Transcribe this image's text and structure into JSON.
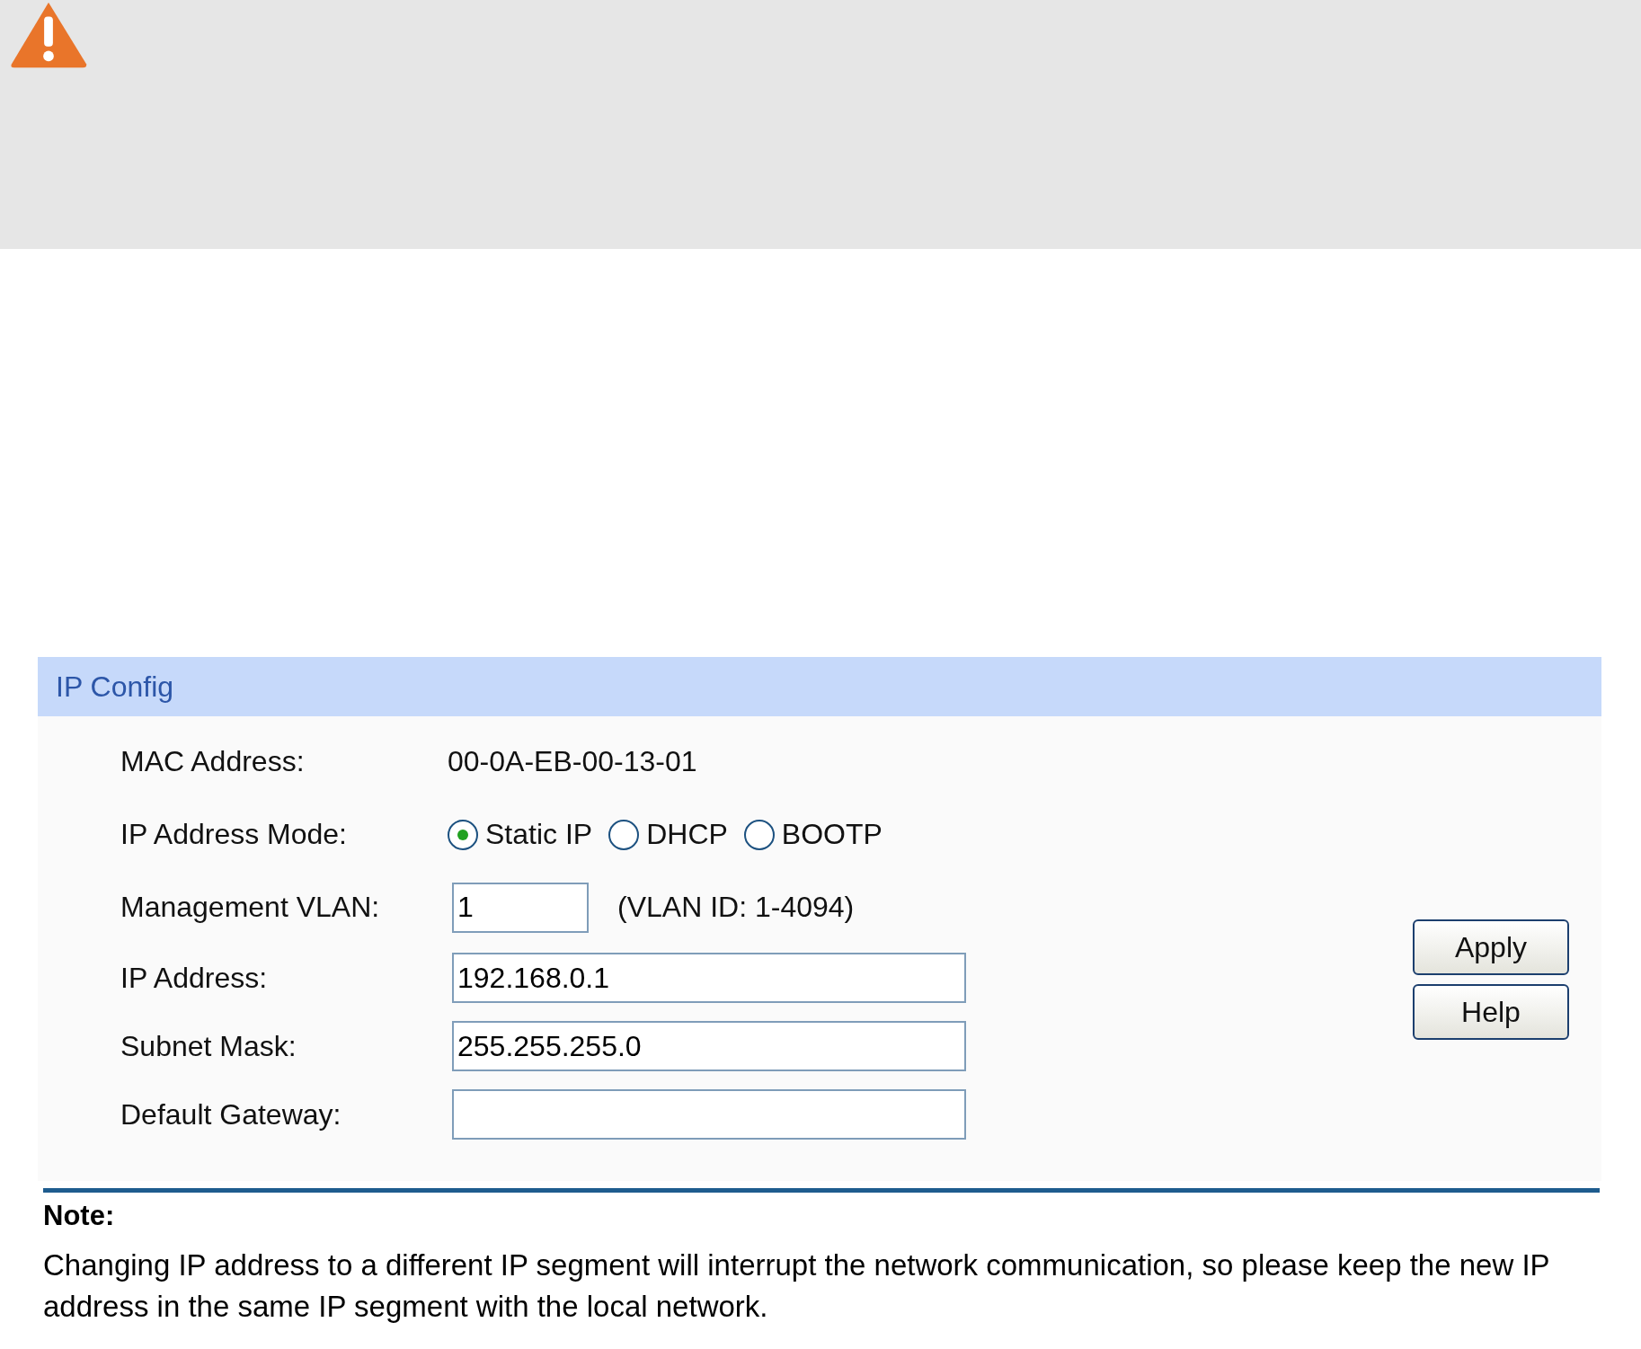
{
  "panel": {
    "title": "IP Config",
    "rows": [
      {
        "kind": "text",
        "label": "MAC Address:",
        "value": "00-0A-EB-00-13-01"
      },
      {
        "kind": "radio",
        "label": "IP Address Mode:",
        "options": [
          {
            "label": "Static IP",
            "selected": true
          },
          {
            "label": "DHCP",
            "selected": false
          },
          {
            "label": "BOOTP",
            "selected": false
          }
        ]
      },
      {
        "kind": "short",
        "label": "Management VLAN:",
        "value": "1",
        "hint": "(VLAN ID: 1-4094)"
      },
      {
        "kind": "field",
        "label": "IP Address:",
        "value": "192.168.0.1"
      },
      {
        "kind": "field",
        "label": "Subnet Mask:",
        "value": "255.255.255.0"
      },
      {
        "kind": "field",
        "label": "Default Gateway:"
      }
    ],
    "buttons": [
      "Apply",
      "Help"
    ]
  },
  "note": {
    "title": "Note:",
    "text": "Changing IP address to a different IP segment will interrupt the network communication, so please keep the new IP address in the same IP segment with the local network."
  }
}
